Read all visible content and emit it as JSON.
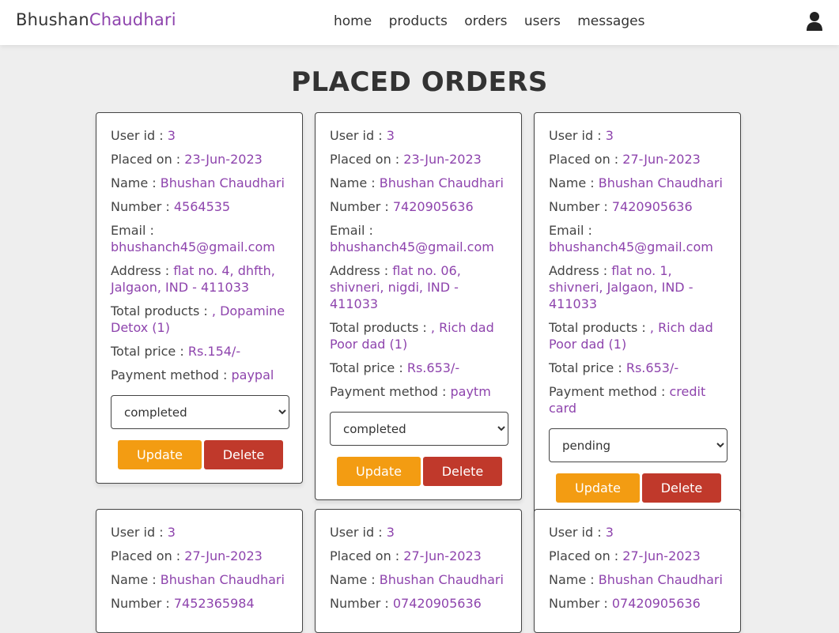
{
  "header": {
    "logo_part1": "Bhushan",
    "logo_part2": "Chaudhari",
    "nav": [
      "home",
      "products",
      "orders",
      "users",
      "messages"
    ]
  },
  "page_title": "PLACED ORDERS",
  "labels": {
    "user_id": "User id : ",
    "placed_on": "Placed on : ",
    "name": "Name : ",
    "number": "Number : ",
    "email": "Email : ",
    "address": "Address : ",
    "total_products": "Total products : ",
    "total_price": "Total price : ",
    "payment_method": "Payment method : ",
    "update": "Update",
    "delete": "Delete"
  },
  "status_options": [
    "pending",
    "completed"
  ],
  "orders": [
    {
      "user_id": "3",
      "placed_on": "23-Jun-2023",
      "name": "Bhushan Chaudhari",
      "number": "4564535",
      "email": "bhushanch45@gmail.com",
      "address": "flat no. 4, dhfth, Jalgaon, IND - 411033",
      "total_products": ", Dopamine Detox (1)",
      "total_price": "Rs.154/-",
      "payment_method": "paypal",
      "status": "completed"
    },
    {
      "user_id": "3",
      "placed_on": "23-Jun-2023",
      "name": "Bhushan Chaudhari",
      "number": "7420905636",
      "email": "bhushanch45@gmail.com",
      "address": "flat no. 06, shivneri, nigdi, IND - 411033",
      "total_products": ", Rich dad Poor dad (1)",
      "total_price": "Rs.653/-",
      "payment_method": "paytm",
      "status": "completed"
    },
    {
      "user_id": "3",
      "placed_on": "27-Jun-2023",
      "name": "Bhushan Chaudhari",
      "number": "7420905636",
      "email": "bhushanch45@gmail.com",
      "address": "flat no. 1, shivneri, Jalgaon, IND - 411033",
      "total_products": ", Rich dad Poor dad (1)",
      "total_price": "Rs.653/-",
      "payment_method": "credit card",
      "status": "pending"
    },
    {
      "user_id": "3",
      "placed_on": "27-Jun-2023",
      "name": "Bhushan Chaudhari",
      "number": "7452365984"
    },
    {
      "user_id": "3",
      "placed_on": "27-Jun-2023",
      "name": "Bhushan Chaudhari",
      "number": "07420905636"
    },
    {
      "user_id": "3",
      "placed_on": "27-Jun-2023",
      "name": "Bhushan Chaudhari",
      "number": "07420905636"
    }
  ],
  "colors": {
    "accent": "#8e44ad",
    "update": "#f39c12",
    "delete": "#c0392b"
  },
  "icons": {
    "profile": "user-icon"
  }
}
